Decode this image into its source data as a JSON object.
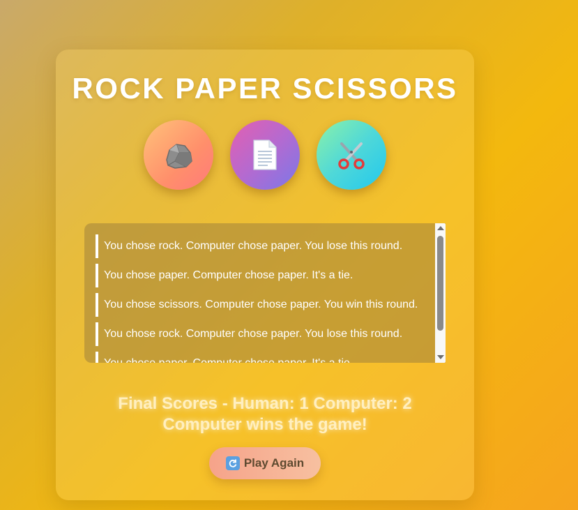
{
  "game": {
    "title": "ROCK PAPER SCISSORS",
    "choices": [
      {
        "id": "rock",
        "icon": "rock-icon"
      },
      {
        "id": "paper",
        "icon": "paper-icon"
      },
      {
        "id": "scissors",
        "icon": "scissors-icon"
      }
    ]
  },
  "log": {
    "entries": [
      "You chose rock. Computer chose paper. You lose this round.",
      "You chose paper. Computer chose paper. It's a tie.",
      "You chose scissors. Computer chose paper. You win this round.",
      "You chose rock. Computer chose paper. You lose this round.",
      "You chose paper. Computer chose paper. It's a tie."
    ]
  },
  "result": {
    "final_scores": "Final Scores - Human: 1 Computer: 2",
    "winner": "Computer wins the game!"
  },
  "actions": {
    "play_again_label": "Play Again",
    "play_again_icon": "replay-icon"
  },
  "colors": {
    "rock_gradient": [
      "#ffc27a",
      "#ff7a7a"
    ],
    "paper_gradient": [
      "#e45fb0",
      "#7b78e8"
    ],
    "scissors_gradient": [
      "#8cf2a8",
      "#22c8ee"
    ],
    "button_gradient": [
      "#f6a38a",
      "#f7c0a0"
    ]
  }
}
